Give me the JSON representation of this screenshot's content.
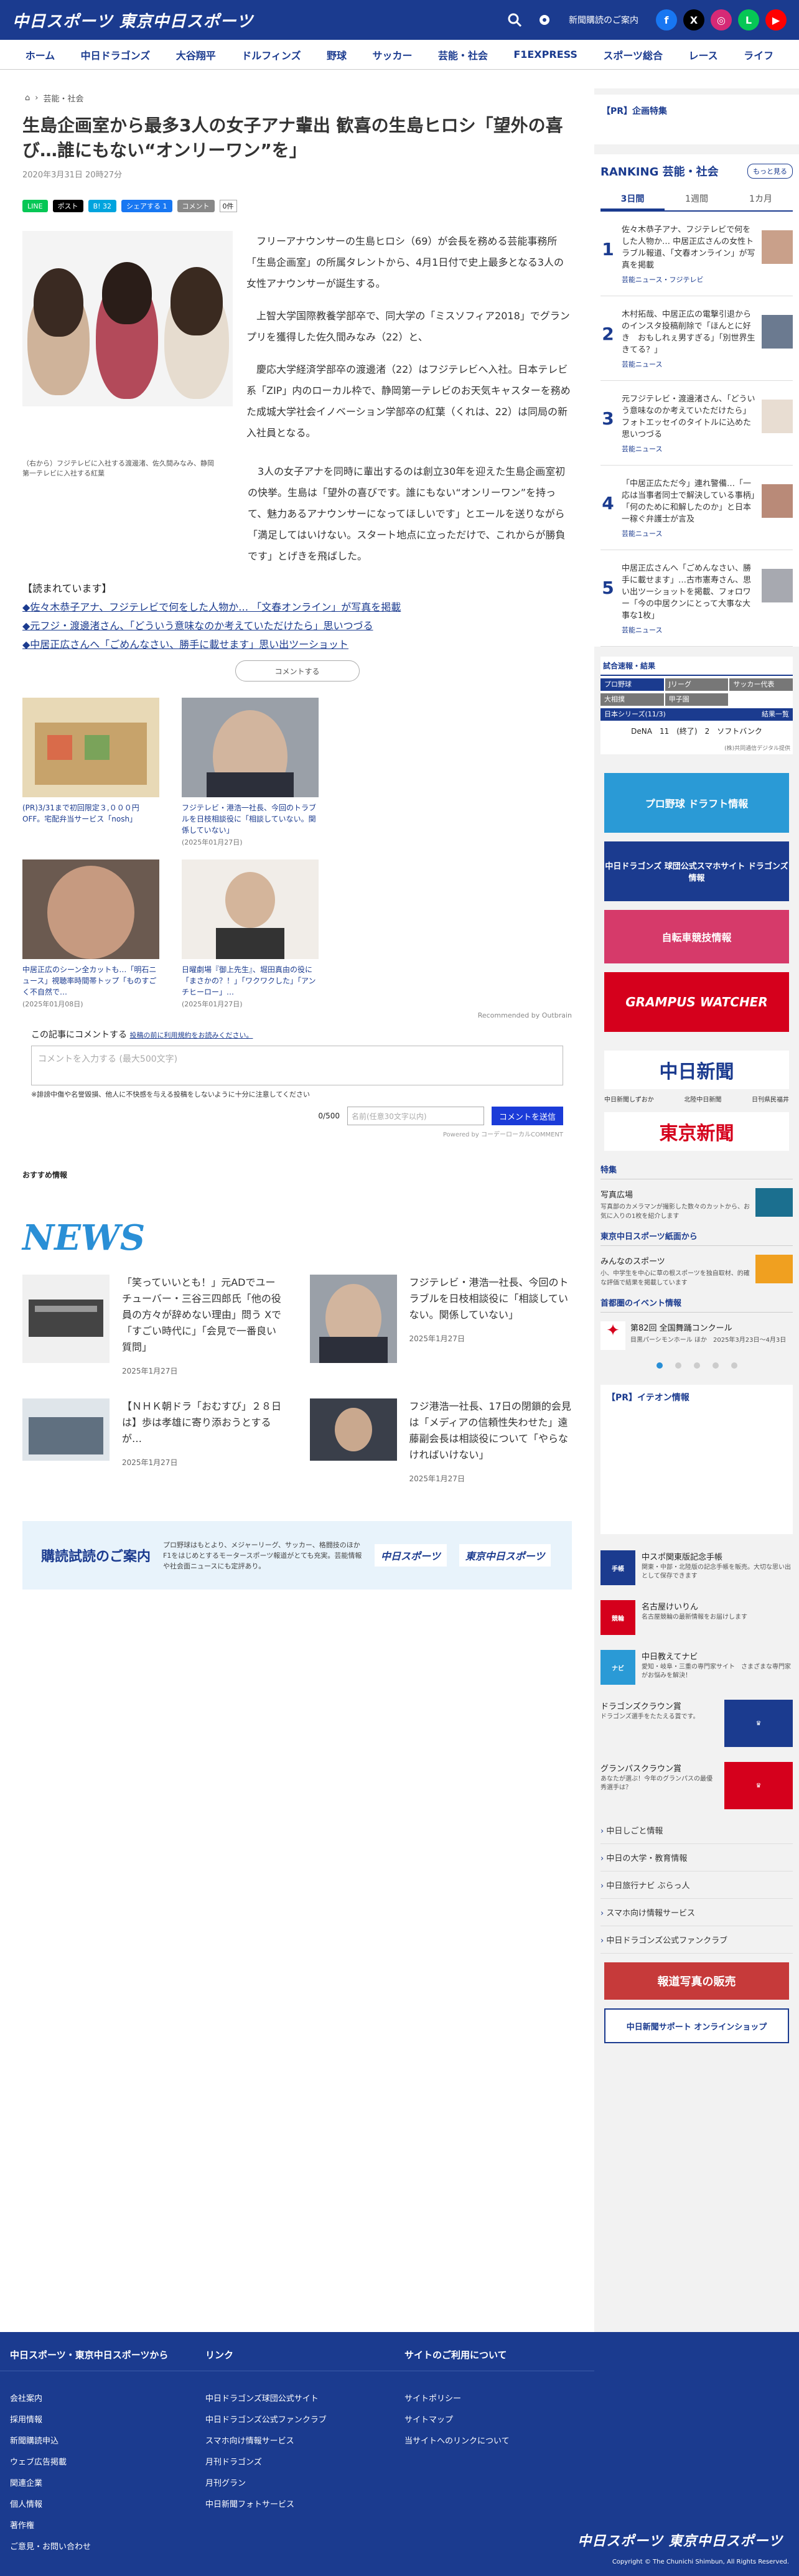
{
  "header": {
    "logo": "中日スポーツ 東京中日スポーツ",
    "subscribe": "新聞購読のご案内",
    "colors": {
      "brand": "#1b3b8f",
      "accent": "#2a8fd6"
    }
  },
  "nav": [
    "ホーム",
    "中日ドラゴンズ",
    "大谷翔平",
    "ドルフィンズ",
    "野球",
    "サッカー",
    "芸能・社会",
    "F1EXPRESS",
    "スポーツ総合",
    "レース",
    "ライフ"
  ],
  "breadcrumb": {
    "current": "芸能・社会"
  },
  "article": {
    "title": "生島企画室から最多3人の女子アナ輩出 歓喜の生島ヒロシ「望外の喜び…誰にもない“オンリーワン”を」",
    "date": "2020年3月31日 20時27分",
    "share": {
      "line": "LINE",
      "post": "ポスト",
      "bcount": "B! 32",
      "fb": "シェアする 1",
      "comment": "コメント",
      "ccount": "0件"
    },
    "caption": "（右から）フジテレビに入社する渡邊渚、佐久間みなみ、静岡第一テレビに入社する紅葉",
    "paras": [
      "フリーアナウンサーの生島ヒロシ（69）が会長を務める芸能事務所「生島企画室」の所属タレントから、4月1日付で史上最多となる3人の女性アナウンサーが誕生する。",
      "上智大学国際教養学部卒で、同大学の「ミスソフィア2018」でグランプリを獲得した佐久間みなみ（22）と、",
      "慶応大学経済学部卒の渡邊渚（22）はフジテレビへ入社。日本テレビ系「ZIP」内のローカル枠で、静岡第一テレビのお天気キャスターを務めた成城大学社会イノベーション学部卒の紅葉（くれは、22）は同局の新入社員となる。"
    ],
    "full": "3人の女子アナを同時に輩出するのは創立30年を迎えた生島企画室初の快挙。生島は「望外の喜びです。誰にもない“オンリーワン”を持って、魅力あるアナウンサーになってほしいです」とエールを送りながら「満足してはいけない。スタート地点に立っただけで、これからが勝負です」とげきを飛ばした。",
    "related_h": "【読まれています】",
    "related": [
      "◆佐々木恭子アナ、フジテレビで何をした人物か… 「文春オンライン」が写真を掲載",
      "◆元フジ・渡邊渚さん、「どういう意味なのか考えていただけたら」思いつづる",
      "◆中居正広さんへ「ごめんなさい、勝手に載せます」思い出ツーショット"
    ],
    "comment_btn": "コメントする"
  },
  "cards": [
    {
      "t": "(PR)3/31まで初回限定３,０００円OFF。宅配弁当サービス「nosh」",
      "d": ""
    },
    {
      "t": "フジテレビ・港浩一社長、今回のトラブルを日枝相談役に「相談していない。関係していない」",
      "d": "(2025年01月27日)"
    },
    {
      "t": "中居正広のシーン全カットも…「明石ニュース」視聴率時間帯トップ「ものすごく不自然で…",
      "d": "(2025年01月08日)"
    },
    {
      "t": "日曜劇場『御上先生』、堀田真由の役に「まさかの？！」「ワクワクした」「アンチヒーロー」…",
      "d": "(2025年01月27日)"
    }
  ],
  "outbrain": "Recommended by Outbrain",
  "comment": {
    "head": "この記事にコメントする",
    "rules": "投稿の前に利用規約をお読みください。",
    "placeholder": "コメントを入力する (最大500文字)",
    "note": "※誹謗中傷や名誉毀損、他人に不快感を与える投稿をしないように十分に注意してください",
    "count": "0/500",
    "name_ph": "名前(任意30文字以内)",
    "submit": "コメントを送信",
    "powered": "Powered by コーデーローカルCOMMENT"
  },
  "recommend": "おすすめ情報",
  "news": {
    "heading": "NEWS",
    "items": [
      {
        "t": "「笑っていいとも！」元ADでユーチューバー・三谷三四郎氏「他の役員の方々が辞めない理由」問う Xで「すごい時代に」「会見で一番良い質問」",
        "d": "2025年1月27日"
      },
      {
        "t": "フジテレビ・港浩一社長、今回のトラブルを日枝相談役に「相談していない。関係していない」",
        "d": "2025年1月27日"
      },
      {
        "t": "【ＮＨＫ朝ドラ「おむすび」２８日は】歩は孝雄に寄り添おうとするが…",
        "d": "2025年1月27日"
      },
      {
        "t": "フジ港浩一社長、17日の閉鎖的会見は「メディアの信頼性失わせた」遠藤副会長は相談役について「やらなければいけない」",
        "d": "2025年1月27日"
      }
    ]
  },
  "subscription": {
    "h": "購読試読のご案内",
    "tx": "プロ野球はもとより、メジャーリーグ、サッカー、格闘技のほかF1をはじめとするモータースポーツ報道がとても充実。芸能情報や社会面ニュースにも定評あり。",
    "l1": "中日スポーツ",
    "l2": "東京中日スポーツ"
  },
  "sidebar": {
    "pr": "【PR】企画特集",
    "ranking": {
      "h": "RANKING 芸能・社会",
      "more": "もっと見る",
      "tabs": [
        "3日間",
        "1週間",
        "1カ月"
      ],
      "items": [
        {
          "n": "1",
          "t": "佐々木恭子アナ、フジテレビで何をした人物か… 中居正広さんの女性トラブル報道、「文春オンライン」が写真を掲載",
          "c": "芸能ニュース・フジテレビ"
        },
        {
          "n": "2",
          "t": "木村拓哉、中居正広の電撃引退からのインスタ投稿削除で「ほんとに好き　おもしれぇ男すぎる」「別世界生きてる？」",
          "c": "芸能ニュース"
        },
        {
          "n": "3",
          "t": "元フジテレビ・渡邊渚さん、「どういう意味なのか考えていただけたら」フォトエッセイのタイトルに込めた思いつづる",
          "c": "芸能ニュース"
        },
        {
          "n": "4",
          "t": "「中居正広ただ今」連れ警備…「一応は当事者同士で解決している事柄」「何のために和解したのか」と日本一稼ぐ弁護士が言及",
          "c": "芸能ニュース"
        },
        {
          "n": "5",
          "t": "中居正広さんへ「ごめんなさい、勝手に載せます」…古市憲寿さん、思い出ツーショットを掲載、フォロワー「今の中居クンにとって大事な大事な1枚」",
          "c": "芸能ニュース"
        }
      ]
    },
    "score": {
      "h": "試合速報・結果",
      "tabs": [
        "プロ野球",
        "Jリーグ",
        "サッカー代表",
        "大相撲",
        "甲子園"
      ],
      "game": "日本シリーズ(11/3)",
      "status": "結果一覧",
      "line": "DeNA　11　(終了)　2　ソフトバンク",
      "src": "(株)共同通信デジタル提供"
    },
    "banners": [
      "プロ野球 ドラフト情報",
      "中日ドラゴンズ 球団公式スマホサイト ドラゴンズ情報",
      "自転車競技情報",
      "GRAMPUS WATCHER"
    ],
    "chunichi": "中日新聞",
    "tokyo": "東京新聞",
    "small": [
      "中日新聞しずおか",
      "北陸中日新聞",
      "日刊県民福井"
    ],
    "tokushu": "特集",
    "shashin": {
      "h": "写真広場",
      "p": "写真部のカメラマンが撮影した数々のカットから、お気に入りの1枚を紹介します"
    },
    "tmsports": "東京中日スポーツ紙面から",
    "minna": {
      "h": "みんなのスポーツ",
      "p": "小、中学生を中心に草の根スポーツを独自取材、的確な評価で結果を掲載しています"
    },
    "event_h": "首都圏のイベント情報",
    "event": {
      "h": "第82回 全国舞踊コンクール",
      "p": "目黒パーシモンホール ほか　2025年3月23日〜4月3日"
    },
    "ion": "【PR】イテオン情報",
    "check": [
      {
        "h": "中スポ関東版記念手帳",
        "p": "関東・中部・北陸版の記念手帳を販売。大切な思い出として保存できます"
      },
      {
        "h": "名古屋けいりん",
        "p": "名古屋競輪の最新情報をお届けします"
      },
      {
        "h": "中日教えてナビ",
        "p": "愛知・岐阜・三重の専門家サイト　さまざまな専門家がお悩みを解決！"
      }
    ],
    "clown1": {
      "h": "ドラゴンズクラウン賞",
      "p": "ドラゴンズ選手をたたえる賞です。"
    },
    "clown2": {
      "h": "グランパスクラウン賞",
      "p": "あなたが選ぶ！今年のグランパスの最優秀選手は？"
    },
    "links": [
      "中日しごと情報",
      "中日の大学・教育情報",
      "中日旅行ナビ ぶらっ人",
      "スマホ向け情報サービス",
      "中日ドラゴンズ公式ファンクラブ"
    ],
    "photo_service": "報道写真の販売",
    "online_shop": "中日新聞サポート オンラインショップ"
  },
  "footer": {
    "c1": {
      "h": "中日スポーツ・東京中日スポーツから",
      "items": [
        "会社案内",
        "採用情報",
        "新聞購読申込",
        "ウェブ広告掲載",
        "関連企業",
        "個人情報",
        "著作権",
        "ご意見・お問い合わせ"
      ]
    },
    "c2": {
      "h": "リンク",
      "items": [
        "中日ドラゴンズ球団公式サイト",
        "中日ドラゴンズ公式ファンクラブ",
        "スマホ向け情報サービス",
        "月刊ドラゴンズ",
        "月刊グラン",
        "中日新聞フォトサービス"
      ]
    },
    "c3": {
      "h": "サイトのご利用について",
      "items": [
        "サイトポリシー",
        "サイトマップ",
        "当サイトへのリンクについて"
      ]
    },
    "copy": "Copyright © The Chunichi Shimbun, All Rights Reserved."
  }
}
